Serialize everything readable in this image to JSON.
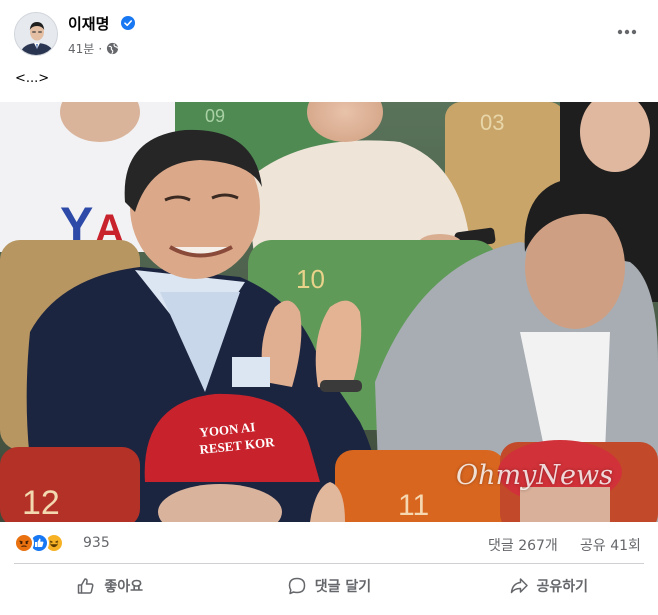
{
  "post": {
    "author": "이재명",
    "time": "41분",
    "caption": "<...>",
    "watermark": "OhmyNews",
    "hat_text": "YOON AIR RESET KOR",
    "seat_numbers": [
      "12",
      "11",
      "09",
      "03",
      "10"
    ]
  },
  "stats": {
    "reaction_icons": [
      "angry-icon",
      "like-icon",
      "haha-icon"
    ],
    "reaction_count": "935",
    "comments": "댓글 267개",
    "shares": "공유 41회"
  },
  "actions": {
    "like": "좋아요",
    "comment": "댓글 달기",
    "share": "공유하기"
  },
  "colors": {
    "verified": "#1877f2",
    "like": "#1877f2",
    "angry": "#e9710f",
    "haha": "#f7b125",
    "seat_green": "#5f9a58",
    "seat_orange": "#d9661f",
    "seat_red": "#b43128",
    "hat_red": "#c8232c"
  }
}
